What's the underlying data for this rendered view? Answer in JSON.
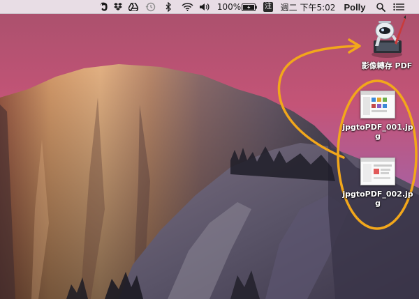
{
  "menubar": {
    "battery_percent": "100%",
    "input_method_badge": "注",
    "clock": "週二 下午5:02",
    "user_name": "Polly",
    "status_icons": [
      "evernote-icon",
      "dropbox-icon",
      "google-drive-icon",
      "time-machine-icon",
      "bluetooth-icon",
      "wifi-icon",
      "volume-icon",
      "battery-icon",
      "input-method-icon",
      "spotlight-icon",
      "notification-center-icon"
    ]
  },
  "desktop": {
    "items": [
      {
        "label": "影像轉存 PDF",
        "type": "automator-app"
      },
      {
        "label_line1": "jpgtoPDF_001.jp",
        "label_line2": "g",
        "type": "image-file"
      },
      {
        "label_line1": "jpgtoPDF_002.jp",
        "label_line2": "g",
        "type": "image-file"
      }
    ]
  },
  "annotation_color": "#f2a71b",
  "colors": {
    "sky_top": "#c54f6e",
    "sky_bottom": "#a46ab2",
    "rock_warm": "#c98a5e",
    "rock_shadow": "#4a4250",
    "menubar_bg": "#eee9f0"
  }
}
